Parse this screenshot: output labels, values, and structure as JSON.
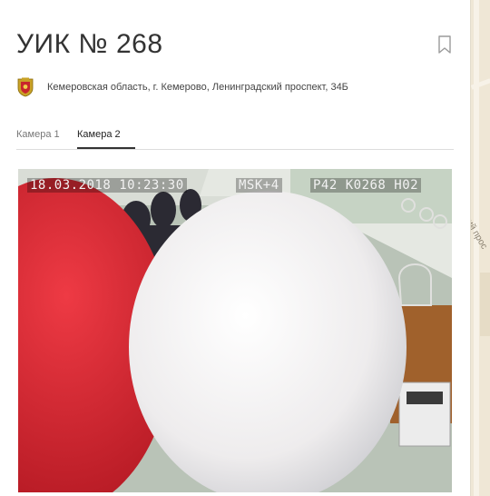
{
  "station": {
    "title": "УИК № 268",
    "address": "Кемеровская область, г. Кемерово, Ленинградский проспект, 34Б"
  },
  "tabs": [
    {
      "label": "Камера 1",
      "active": false
    },
    {
      "label": "Камера 2",
      "active": true
    }
  ],
  "video": {
    "timestamp": "18.03.2018 10:23:30",
    "timezone": "MSK+4",
    "station_code": "P42 K0268 H02"
  },
  "map": {
    "street_label": "ий прос"
  },
  "colors": {
    "accent": "#333333",
    "balloon_red": "#d3222e",
    "balloon_white": "#f1eff0"
  },
  "icons": {
    "bookmark": "bookmark-icon",
    "coat_of_arms": "coat-of-arms-icon"
  }
}
